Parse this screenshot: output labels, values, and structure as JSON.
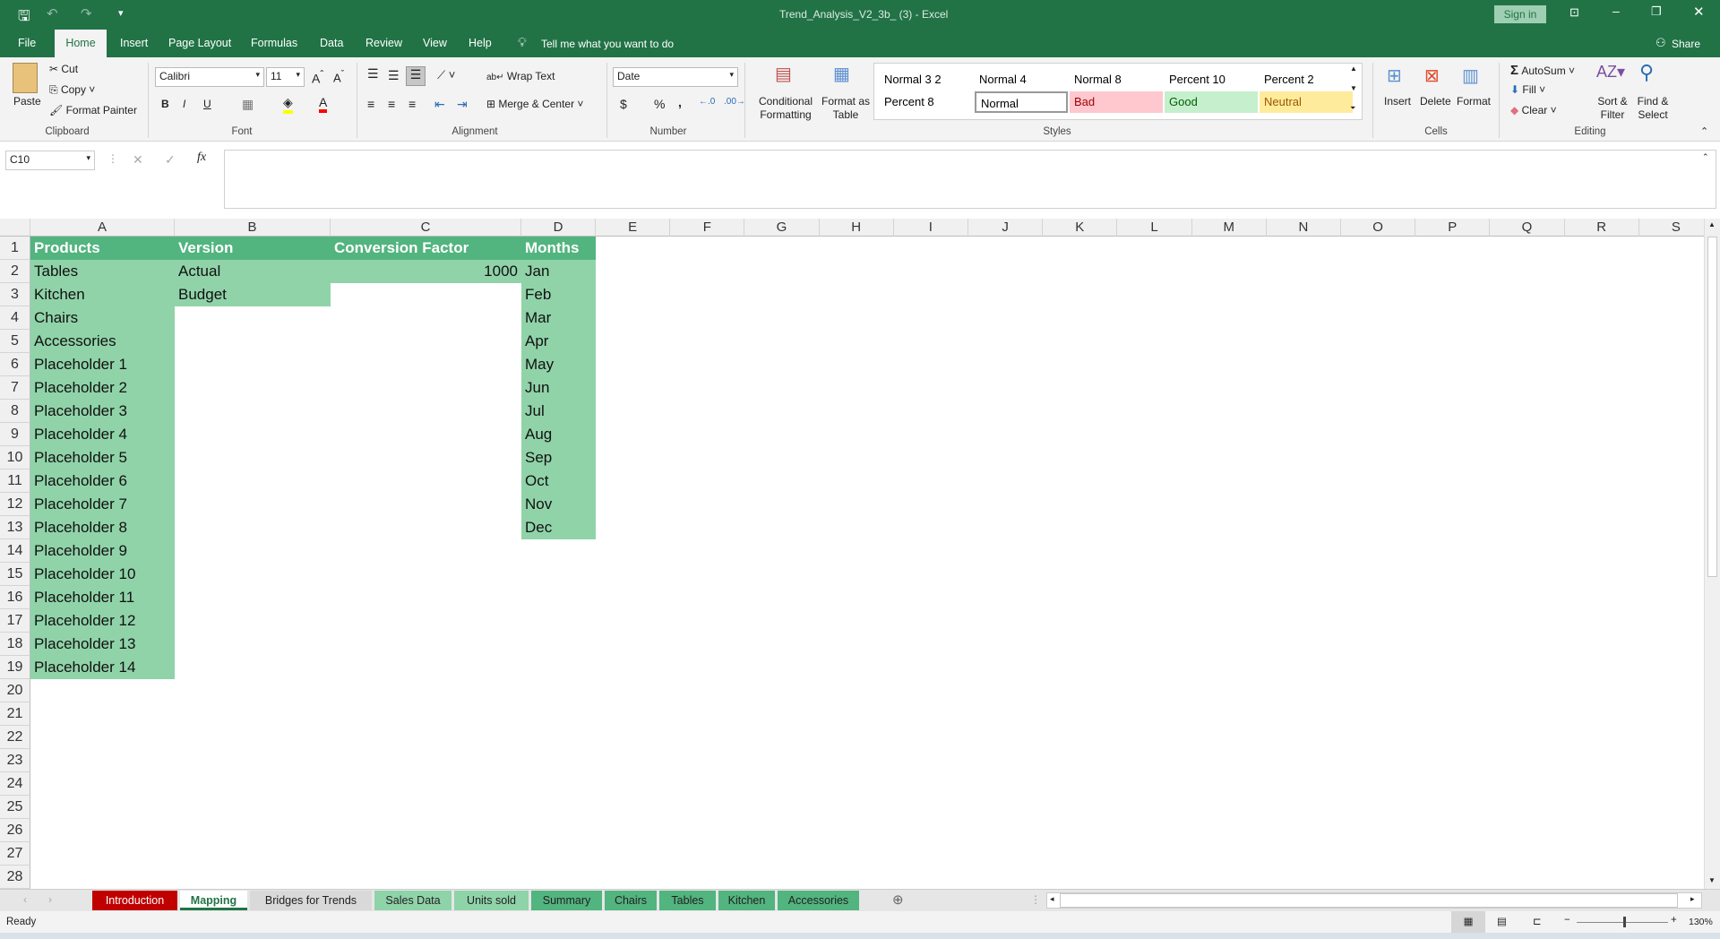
{
  "window": {
    "title": "Trend_Analysis_V2_3b_ (3)  -  Excel",
    "sign_in": "Sign in",
    "share": "Share"
  },
  "ribbon_tabs": [
    "File",
    "Home",
    "Insert",
    "Page Layout",
    "Formulas",
    "Data",
    "Review",
    "View",
    "Help"
  ],
  "tell_me": "Tell me what you want to do",
  "clipboard": {
    "paste": "Paste",
    "cut": "Cut",
    "copy": "Copy",
    "format_painter": "Format Painter",
    "label": "Clipboard"
  },
  "font": {
    "name": "Calibri",
    "size": "11",
    "bold": "B",
    "italic": "I",
    "underline": "U",
    "label": "Font"
  },
  "alignment": {
    "wrap": "Wrap Text",
    "merge": "Merge & Center",
    "label": "Alignment"
  },
  "number": {
    "format": "Date",
    "currency": "$",
    "percent": "%",
    "comma": ",",
    "label": "Number"
  },
  "styles": {
    "conditional": "Conditional Formatting",
    "format_table": "Format as Table",
    "label": "Styles",
    "gallery": [
      {
        "name": "Normal 3 2",
        "bg": "#ffffff",
        "fg": "#000000"
      },
      {
        "name": "Normal 4",
        "bg": "#ffffff",
        "fg": "#000000"
      },
      {
        "name": "Normal 8",
        "bg": "#ffffff",
        "fg": "#000000"
      },
      {
        "name": "Percent 10",
        "bg": "#ffffff",
        "fg": "#000000"
      },
      {
        "name": "Percent 2",
        "bg": "#ffffff",
        "fg": "#000000"
      },
      {
        "name": "Percent 8",
        "bg": "#ffffff",
        "fg": "#000000"
      },
      {
        "name": "Normal",
        "bg": "#ffffff",
        "fg": "#000000"
      },
      {
        "name": "Bad",
        "bg": "#ffc7ce",
        "fg": "#9c0006"
      },
      {
        "name": "Good",
        "bg": "#c6efce",
        "fg": "#006100"
      },
      {
        "name": "Neutral",
        "bg": "#ffeb9c",
        "fg": "#9c5700"
      }
    ]
  },
  "cells_group": {
    "insert": "Insert",
    "delete": "Delete",
    "format": "Format",
    "label": "Cells"
  },
  "editing": {
    "autosum": "AutoSum",
    "fill": "Fill",
    "clear": "Clear",
    "sort": "Sort & Filter",
    "find": "Find & Select",
    "label": "Editing"
  },
  "namebox": "C10",
  "columns": [
    "A",
    "B",
    "C",
    "D",
    "E",
    "F",
    "G",
    "H",
    "I",
    "J",
    "K",
    "L",
    "M",
    "N",
    "O",
    "P",
    "Q",
    "R",
    "S"
  ],
  "rows": [
    "1",
    "2",
    "3",
    "4",
    "5",
    "6",
    "7",
    "8",
    "9",
    "10",
    "11",
    "12",
    "13",
    "14",
    "15",
    "16",
    "17",
    "18",
    "19",
    "20",
    "21",
    "22",
    "23",
    "24",
    "25",
    "26",
    "27",
    "28"
  ],
  "colors": {
    "header_fill": "#52b47f",
    "light_fill": "#90d3a9",
    "excel_green": "#217346"
  },
  "sheet": {
    "headers": [
      "Products",
      "Version",
      "Conversion Factor",
      "Months"
    ],
    "products": [
      "Tables",
      "Kitchen",
      "Chairs",
      "Accessories",
      "Placeholder 1",
      "Placeholder 2",
      "Placeholder 3",
      "Placeholder 4",
      "Placeholder 5",
      "Placeholder 6",
      "Placeholder 7",
      "Placeholder 8",
      "Placeholder 9",
      "Placeholder 10",
      "Placeholder 11",
      "Placeholder 12",
      "Placeholder 13",
      "Placeholder 14"
    ],
    "versions": [
      "Actual",
      "Budget"
    ],
    "conversion_factor": "1000",
    "months": [
      "Jan",
      "Feb",
      "Mar",
      "Apr",
      "May",
      "Jun",
      "Jul",
      "Aug",
      "Sep",
      "Oct",
      "Nov",
      "Dec"
    ]
  },
  "sheet_tabs": [
    {
      "name": "Introduction",
      "bg": "#c00000",
      "fg": "#ffffff"
    },
    {
      "name": "Mapping",
      "bg": "#ffffff",
      "fg": "#217346",
      "active": true
    },
    {
      "name": "Bridges for Trends",
      "bg": "#d9d9d9",
      "fg": "#222222"
    },
    {
      "name": "Sales Data",
      "bg": "#8fd3a9",
      "fg": "#222222"
    },
    {
      "name": "Units sold",
      "bg": "#8fd3a9",
      "fg": "#222222"
    },
    {
      "name": "Summary",
      "bg": "#52b47f",
      "fg": "#222222"
    },
    {
      "name": "Chairs",
      "bg": "#52b47f",
      "fg": "#222222"
    },
    {
      "name": "Tables",
      "bg": "#52b47f",
      "fg": "#222222"
    },
    {
      "name": "Kitchen",
      "bg": "#52b47f",
      "fg": "#222222"
    },
    {
      "name": "Accessories",
      "bg": "#52b47f",
      "fg": "#222222"
    }
  ],
  "status": {
    "ready": "Ready",
    "zoom": "130%"
  }
}
